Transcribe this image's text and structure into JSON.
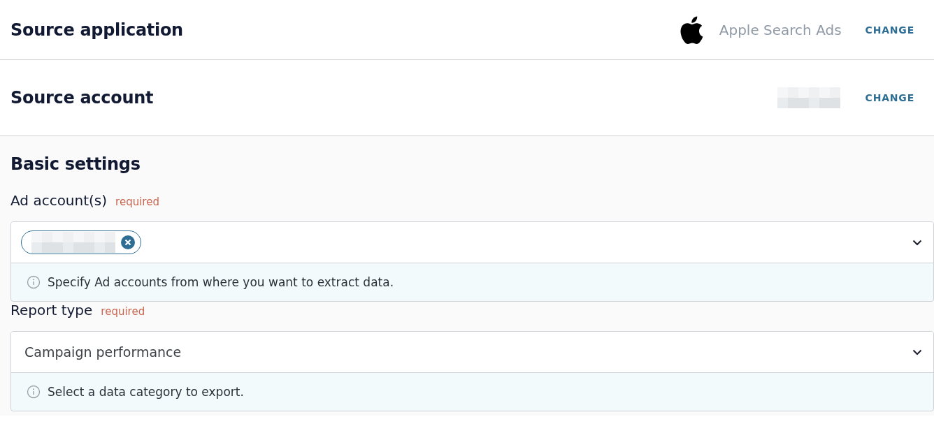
{
  "source_rows": [
    {
      "title": "Source application",
      "value": "Apple Search Ads",
      "kind": "app",
      "action": "CHANGE"
    },
    {
      "title": "Source account",
      "kind": "redacted",
      "action": "CHANGE"
    }
  ],
  "basic_settings": {
    "title": "Basic settings",
    "fields": [
      {
        "label": "Ad account(s)",
        "required": "required",
        "kind": "chips",
        "chips": [
          {
            "kind": "redacted"
          }
        ],
        "hint": "Specify Ad accounts from where you want to extract data."
      },
      {
        "label": "Report type",
        "required": "required",
        "kind": "select",
        "value": "Campaign performance",
        "hint": "Select a data category to export."
      }
    ]
  }
}
